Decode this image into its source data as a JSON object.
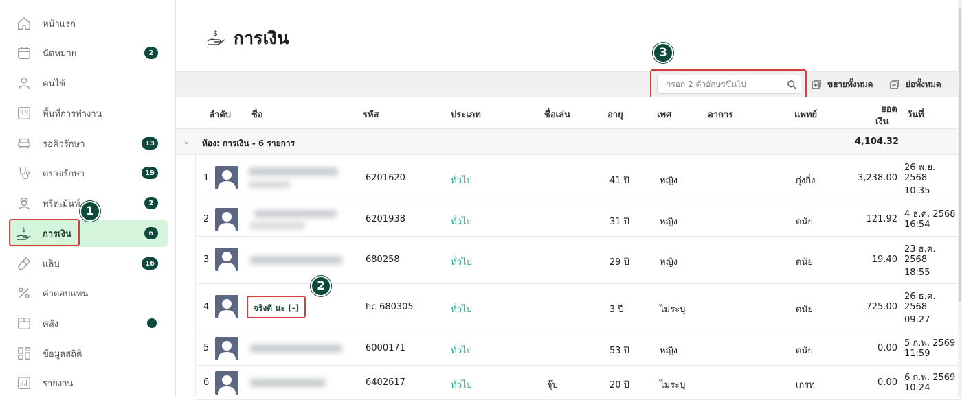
{
  "sidebar": {
    "items": [
      {
        "label": "หน้าแรก",
        "icon": "home-icon"
      },
      {
        "label": "นัดหมาย",
        "icon": "calendar-icon",
        "badge": "2"
      },
      {
        "label": "คนไข้",
        "icon": "user-icon"
      },
      {
        "label": "พื้นที่การทำงาน",
        "icon": "workspace-icon"
      },
      {
        "label": "รอคิวรักษา",
        "icon": "sofa-icon",
        "badge": "13"
      },
      {
        "label": "ตรวจรักษา",
        "icon": "stethoscope-icon",
        "badge": "19"
      },
      {
        "label": "ทรีทเม้นท์",
        "icon": "nurse-icon",
        "badge": "2"
      },
      {
        "label": "การเงิน",
        "icon": "finance-icon",
        "badge": "6",
        "active": true
      },
      {
        "label": "แล็บ",
        "icon": "lab-tube-icon",
        "badge": "16"
      },
      {
        "label": "ค่าตอบแทน",
        "icon": "percent-icon"
      },
      {
        "label": "คลัง",
        "icon": "storage-box-icon",
        "dot": true
      },
      {
        "label": "ข้อมูลสถิติ",
        "icon": "stats-grid-icon"
      },
      {
        "label": "รายงาน",
        "icon": "report-chart-icon"
      }
    ]
  },
  "steps": {
    "one": "1",
    "two": "2",
    "three": "3"
  },
  "page": {
    "title": "การเงิน"
  },
  "toolbar": {
    "search_placeholder": "กรอก 2 ตัวอักษรขึ้นไป",
    "expand_all": "ขยายทั้งหมด",
    "collapse_all": "ย่อทั้งหมด"
  },
  "table": {
    "headers": {
      "index": "ลำดับ",
      "name": "ชื่อ",
      "code": "รหัส",
      "type": "ประเภท",
      "nickname": "ชื่อเล่น",
      "age": "อายุ",
      "gender": "เพศ",
      "symptom": "อาการ",
      "doctor": "แพทย์",
      "amount_line1": "ยอด",
      "amount_line2": "เงิน",
      "date": "วันที่"
    },
    "group": {
      "label": "ห้อง: การเงิน - 6 รายการ",
      "total": "4,104.32"
    },
    "rows": [
      {
        "no": "1",
        "name": "",
        "code": "6201620",
        "type": "ทั่วไป",
        "nickname": "",
        "age": "41 ปี",
        "gender": "หญิง",
        "symptom": "",
        "doctor": "กุ่งกิ่ง",
        "amount": "3,238.00",
        "date1": "26 พ.ย.",
        "date2": "2568",
        "date3": "10:35"
      },
      {
        "no": "2",
        "name": "",
        "code": "6201938",
        "type": "ทั่วไป",
        "nickname": "",
        "age": "31 ปี",
        "gender": "หญิง",
        "symptom": "",
        "doctor": "ดนัย",
        "amount": "121.92",
        "date1": "4 ธ.ค. 2568",
        "date2": "16:54",
        "date3": ""
      },
      {
        "no": "3",
        "name": "",
        "code": "680258",
        "type": "ทั่วไป",
        "nickname": "",
        "age": "29 ปี",
        "gender": "หญิง",
        "symptom": "",
        "doctor": "ดนัย",
        "amount": "19.40",
        "date1": "23 ธ.ค.",
        "date2": "2568",
        "date3": "18:55"
      },
      {
        "no": "4",
        "name": "จริงดี นะ [-]",
        "code": "hc-680305",
        "type": "ทั่วไป",
        "nickname": "",
        "age": "3 ปี",
        "gender": "ไม่ระบุ",
        "symptom": "",
        "doctor": "ดนัย",
        "amount": "725.00",
        "date1": "26 ธ.ค.",
        "date2": "2568",
        "date3": "09:27"
      },
      {
        "no": "5",
        "name": "",
        "code": "6000171",
        "type": "ทั่วไป",
        "nickname": "",
        "age": "53 ปี",
        "gender": "หญิง",
        "symptom": "",
        "doctor": "ดนัย",
        "amount": "0.00",
        "date1": "5 ก.พ. 2569",
        "date2": "11:59",
        "date3": ""
      },
      {
        "no": "6",
        "name": "",
        "code": "6402617",
        "type": "ทั่วไป",
        "nickname": "จุ๊บ",
        "age": "20 ปี",
        "gender": "ไม่ระบุ",
        "symptom": "",
        "doctor": "เกรท",
        "amount": "0.00",
        "date1": "6 ก.พ. 2569",
        "date2": "10:24",
        "date3": ""
      }
    ]
  },
  "colors": {
    "accent": "#0d4a3c",
    "active_bg": "#d4f5dc",
    "highlight": "#d63d3d",
    "type_link": "#2ab39a"
  }
}
